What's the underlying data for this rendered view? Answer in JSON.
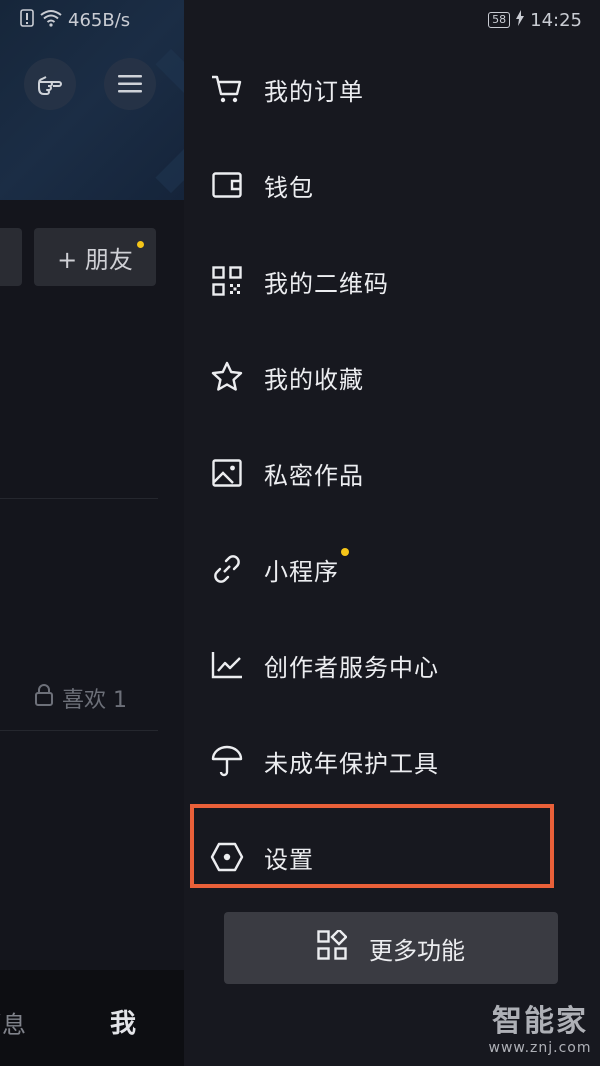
{
  "status_bar": {
    "net_speed": "465B/s",
    "battery": "58",
    "time": "14:25"
  },
  "background_page": {
    "add_friend_label": "+ 朋友",
    "likes_label": "喜欢 1",
    "tab_messages_partial": "消息",
    "tab_me": "我"
  },
  "drawer": {
    "items": [
      {
        "label": "我的订单",
        "icon": "cart-icon"
      },
      {
        "label": "钱包",
        "icon": "wallet-icon"
      },
      {
        "label": "我的二维码",
        "icon": "qr-code-icon"
      },
      {
        "label": "我的收藏",
        "icon": "star-icon"
      },
      {
        "label": "私密作品",
        "icon": "image-icon"
      },
      {
        "label": "小程序",
        "icon": "link-icon",
        "badge": true
      },
      {
        "label": "创作者服务中心",
        "icon": "chart-icon"
      },
      {
        "label": "未成年保护工具",
        "icon": "umbrella-icon"
      },
      {
        "label": "设置",
        "icon": "hexagon-settings-icon",
        "highlighted": true
      }
    ],
    "more_button_label": "更多功能"
  },
  "watermark": {
    "brand": "智能家",
    "url": "www.znj.com"
  },
  "colors": {
    "background": "#17181f",
    "highlight_border": "#ea6039",
    "badge_dot": "#f5c518"
  }
}
